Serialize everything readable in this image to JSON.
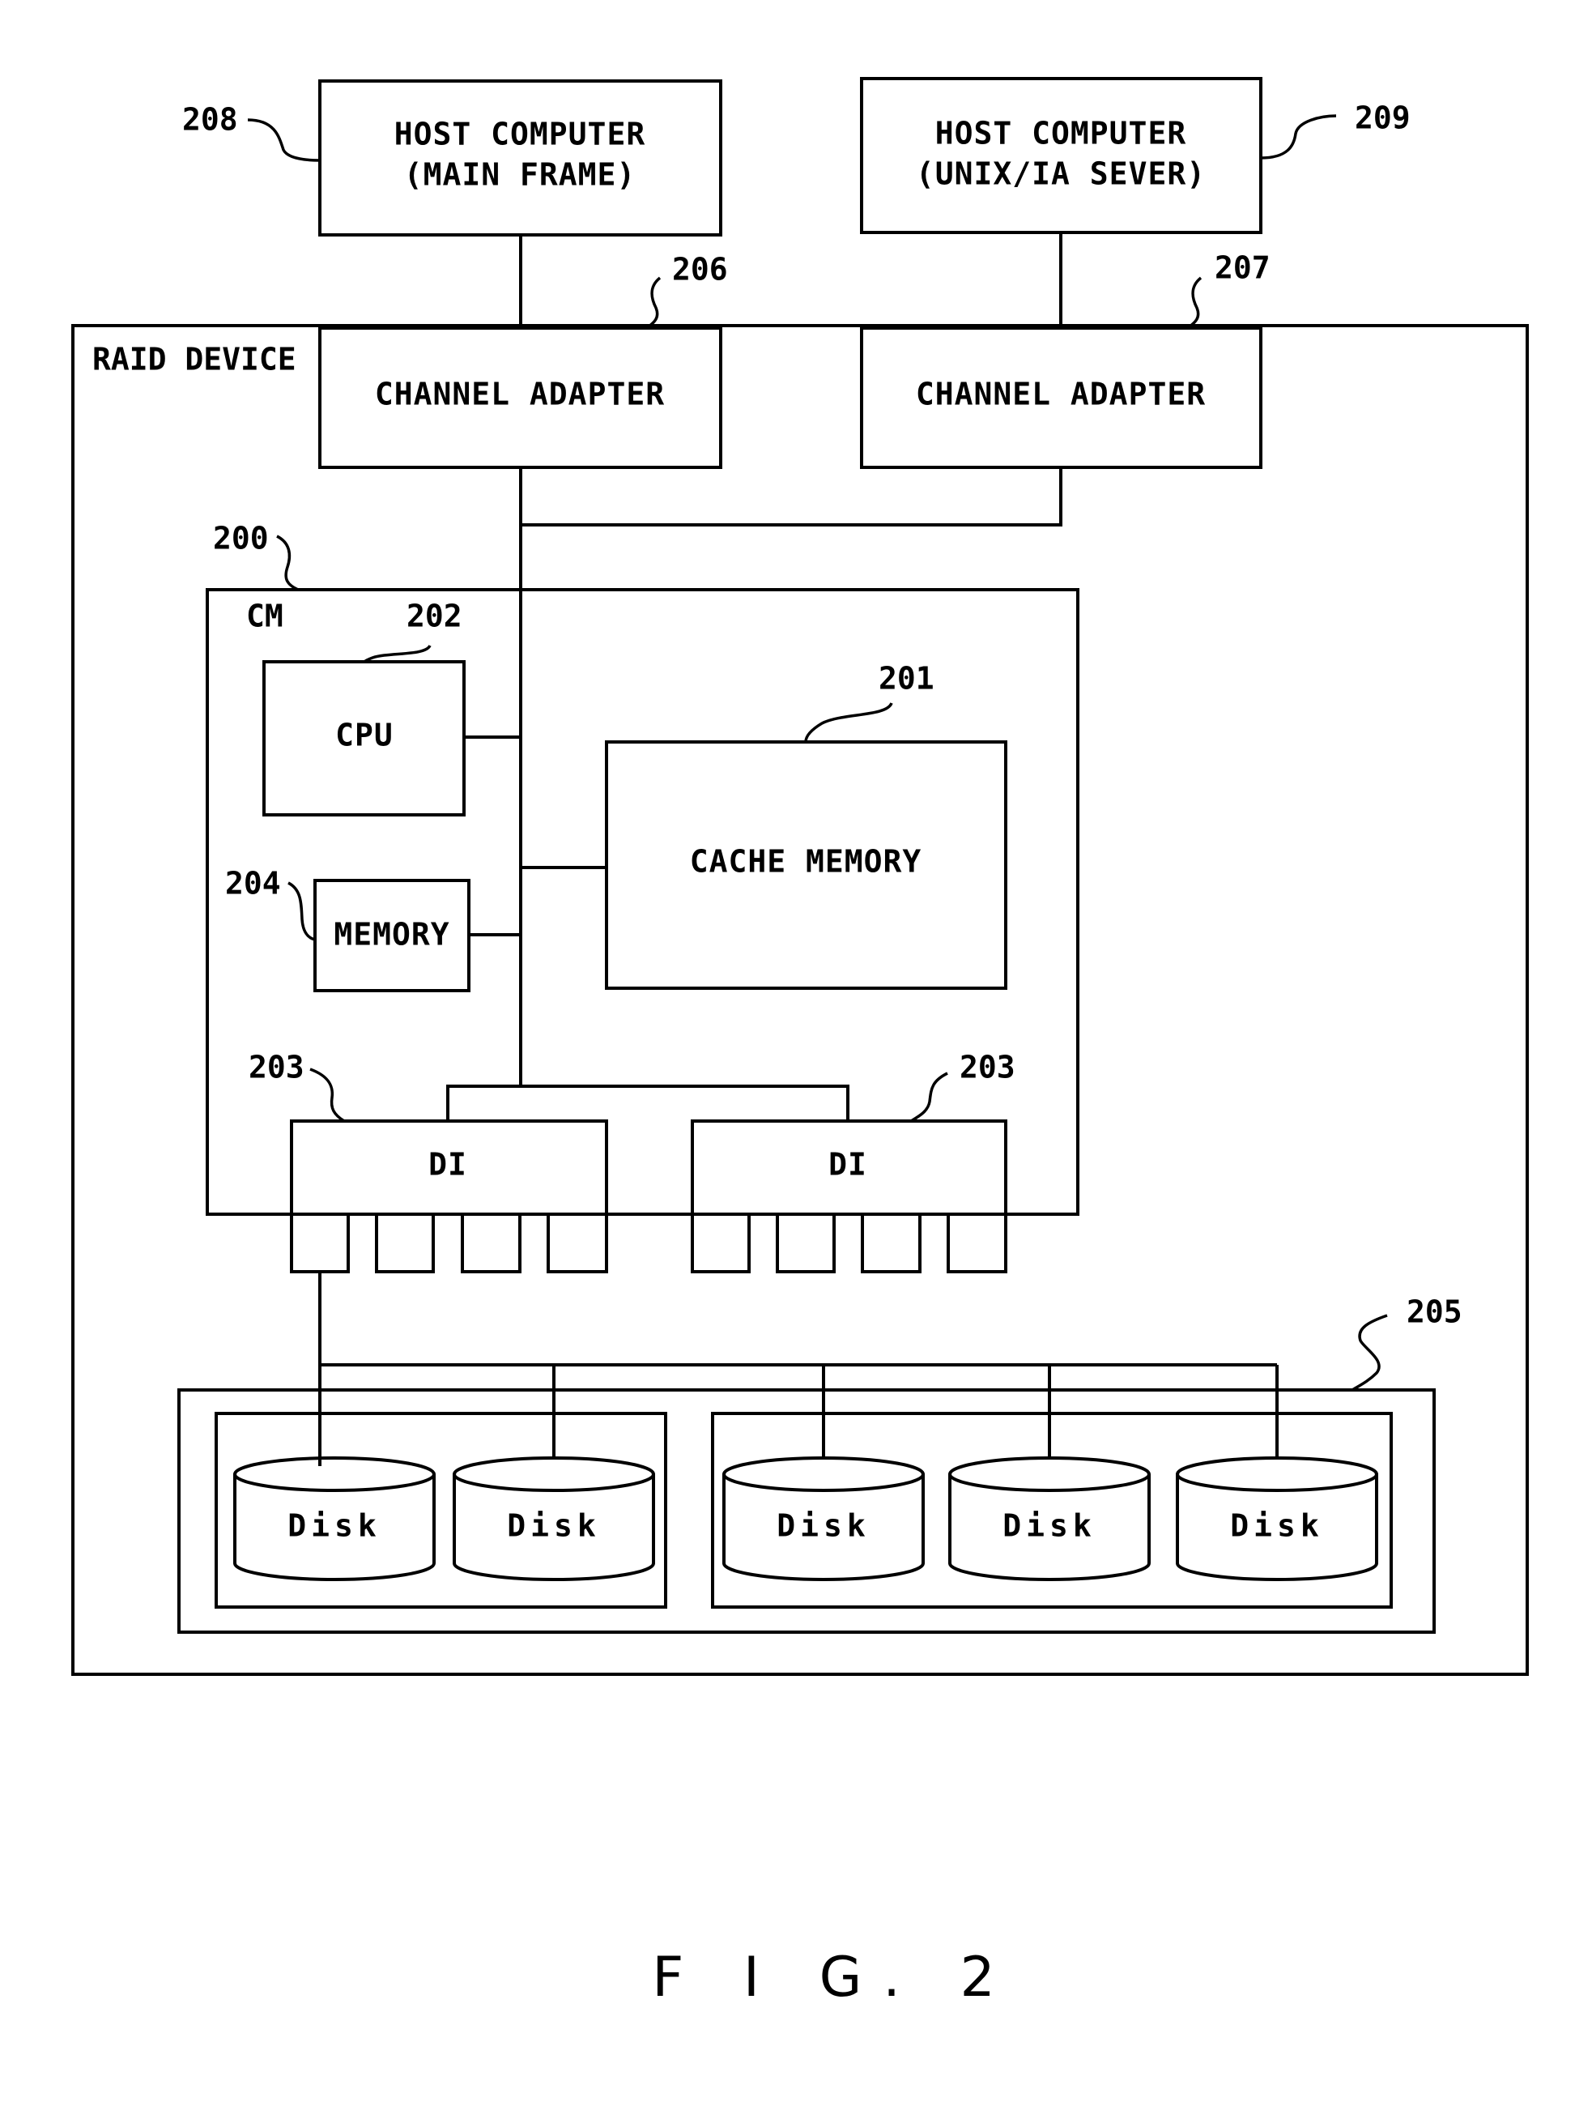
{
  "figure": {
    "caption": "F I G. 2"
  },
  "host_main": {
    "line1": "HOST COMPUTER",
    "line2": "(MAIN FRAME)",
    "ref": "208"
  },
  "host_unix": {
    "line1": "HOST COMPUTER",
    "line2": "(UNIX/IA SEVER)",
    "ref": "209"
  },
  "raid": {
    "label": "RAID DEVICE"
  },
  "channel_adapter_1": {
    "label": "CHANNEL ADAPTER",
    "ref": "206"
  },
  "channel_adapter_2": {
    "label": "CHANNEL ADAPTER",
    "ref": "207"
  },
  "cm": {
    "label": "CM",
    "ref": "200"
  },
  "cpu": {
    "label": "CPU",
    "ref": "202"
  },
  "cache_memory": {
    "label": "CACHE MEMORY",
    "ref": "201"
  },
  "memory": {
    "label": "MEMORY",
    "ref": "204"
  },
  "di_1": {
    "label": "DI",
    "ref": "203"
  },
  "di_2": {
    "label": "DI",
    "ref": "203"
  },
  "disk_enclosure": {
    "ref": "205"
  },
  "disks": [
    {
      "label": "Disk"
    },
    {
      "label": "Disk"
    },
    {
      "label": "Disk"
    },
    {
      "label": "Disk"
    },
    {
      "label": "Disk"
    }
  ]
}
